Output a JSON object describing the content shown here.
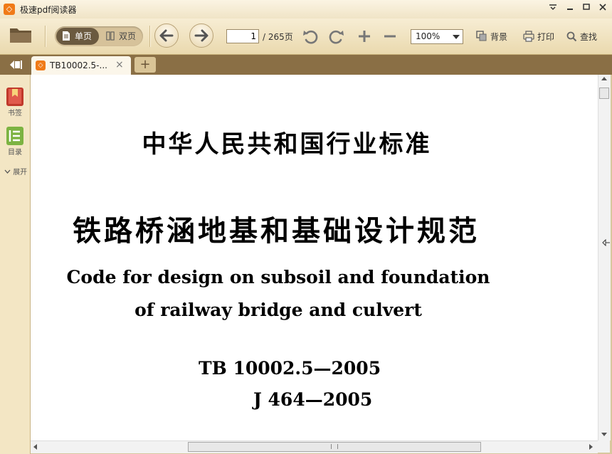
{
  "window": {
    "title": "极速pdf阅读器",
    "logo_text": "◇"
  },
  "toolbar": {
    "single_page_label": "单页",
    "double_page_label": "双页",
    "current_page": "1",
    "page_total": "/ 265页",
    "zoom": "100%",
    "background_label": "背景",
    "print_label": "打印",
    "find_label": "查找"
  },
  "tabs": [
    {
      "label": "TB10002.5-...",
      "close": "×"
    }
  ],
  "tab_add": "+",
  "sidebar": {
    "bookmarks_label": "书签",
    "toc_label": "目录",
    "expand_label": "展开"
  },
  "document": {
    "title_cn": "中华人民共和国行业标准",
    "title_main": "铁路桥涵地基和基础设计规范",
    "title_en_line1": "Code for design on subsoil and foundation",
    "title_en_line2": "of railway bridge and culvert",
    "code_tb": "TB 10002.5—2005",
    "code_j": "J 464—2005"
  },
  "colors": {
    "accent": "#f07a18",
    "toolbar_bg": "#ead9ae",
    "tabstrip_bg": "#8a6f45"
  }
}
